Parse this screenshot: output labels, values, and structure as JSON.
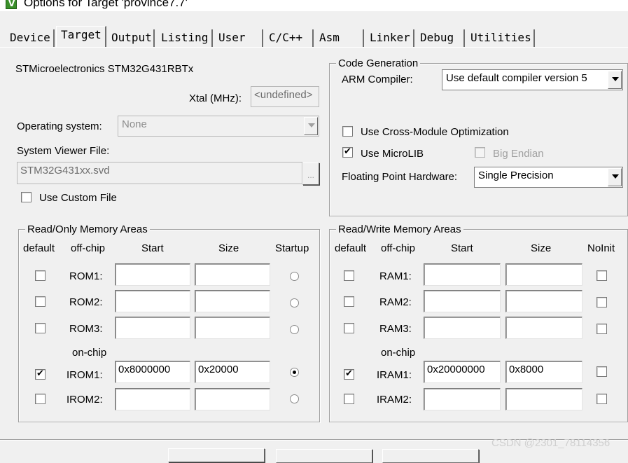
{
  "window": {
    "title": "Options for Target 'province7.7'"
  },
  "tabs": [
    "Device",
    "Target",
    "Output",
    "Listing",
    "User",
    "C/C++",
    "Asm",
    "Linker",
    "Debug",
    "Utilities"
  ],
  "device": {
    "name": "STMicroelectronics STM32G431RBTx"
  },
  "xtal": {
    "label": "Xtal (MHz):",
    "value": "<undefined>"
  },
  "os": {
    "label": "Operating system:",
    "value": "None"
  },
  "svd": {
    "label": "System Viewer File:",
    "value": "STM32G431xx.svd",
    "browse": "...",
    "custom_label": "Use Custom File",
    "custom_checked": false
  },
  "codegen": {
    "title": "Code Generation",
    "compiler_label": "ARM Compiler:",
    "compiler_value": "Use default compiler version 5",
    "cross_module_label": "Use Cross-Module Optimization",
    "cross_module_checked": false,
    "microlib_label": "Use MicroLIB",
    "microlib_checked": true,
    "big_endian_label": "Big Endian",
    "big_endian_checked": false,
    "fpu_label": "Floating Point Hardware:",
    "fpu_value": "Single Precision"
  },
  "rom": {
    "title": "Read/Only Memory Areas",
    "headers": {
      "default": "default",
      "offchip": "off-chip",
      "start": "Start",
      "size": "Size",
      "startup": "Startup"
    },
    "onchip_label": "on-chip",
    "rows": [
      {
        "name": "ROM1:",
        "default": false,
        "start": "",
        "size": "",
        "startup": false
      },
      {
        "name": "ROM2:",
        "default": false,
        "start": "",
        "size": "",
        "startup": false
      },
      {
        "name": "ROM3:",
        "default": false,
        "start": "",
        "size": "",
        "startup": false
      },
      {
        "name": "IROM1:",
        "default": true,
        "start": "0x8000000",
        "size": "0x20000",
        "startup": true
      },
      {
        "name": "IROM2:",
        "default": false,
        "start": "",
        "size": "",
        "startup": false
      }
    ]
  },
  "ram": {
    "title": "Read/Write Memory Areas",
    "headers": {
      "default": "default",
      "offchip": "off-chip",
      "start": "Start",
      "size": "Size",
      "noinit": "NoInit"
    },
    "onchip_label": "on-chip",
    "rows": [
      {
        "name": "RAM1:",
        "default": false,
        "start": "",
        "size": "",
        "noinit": false
      },
      {
        "name": "RAM2:",
        "default": false,
        "start": "",
        "size": "",
        "noinit": false
      },
      {
        "name": "RAM3:",
        "default": false,
        "start": "",
        "size": "",
        "noinit": false
      },
      {
        "name": "IRAM1:",
        "default": true,
        "start": "0x20000000",
        "size": "0x8000",
        "noinit": false
      },
      {
        "name": "IRAM2:",
        "default": false,
        "start": "",
        "size": "",
        "noinit": false
      }
    ]
  },
  "watermark": "CSDN @2301_78114356"
}
